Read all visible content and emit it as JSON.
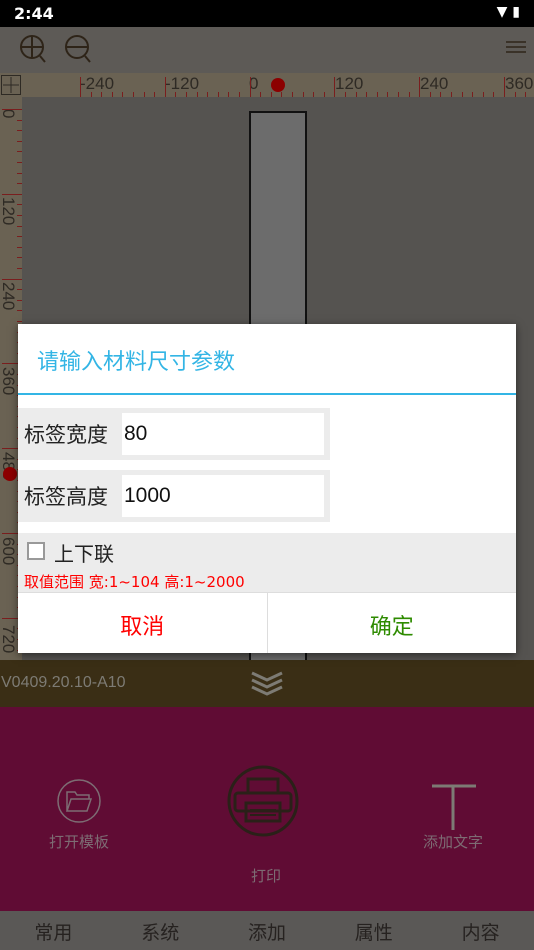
{
  "status": {
    "time": "2:44"
  },
  "ruler": {
    "h_labels": [
      "-240",
      "-120",
      "0",
      "120",
      "240",
      "360"
    ],
    "v_labels": [
      "0",
      "120",
      "240",
      "360",
      "480",
      "600",
      "720"
    ]
  },
  "version": "V0409.20.10-A10",
  "panel": {
    "open_template": "打开模板",
    "print": "打印",
    "add_text": "添加文字"
  },
  "tabs": [
    "常用",
    "系统",
    "添加",
    "属性",
    "内容"
  ],
  "dialog": {
    "title": "请输入材料尺寸参数",
    "width_label": "标签宽度",
    "width_value": "80",
    "height_label": "标签高度",
    "height_value": "1000",
    "checkbox_label": "上下联",
    "checked": false,
    "range_hint": "取值范围 宽:1~104 高:1~2000",
    "cancel": "取消",
    "ok": "确定"
  },
  "colors": {
    "accent": "#33b5e5",
    "cancel": "#ff0000",
    "ok": "#2e8b00",
    "hint": "#ff0000"
  }
}
